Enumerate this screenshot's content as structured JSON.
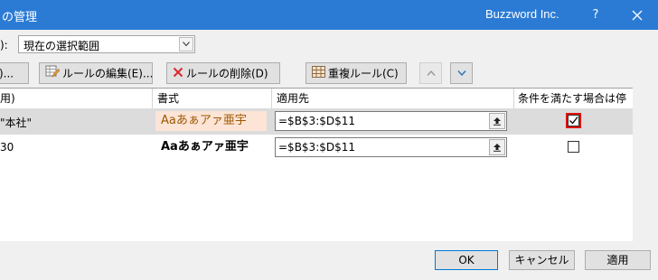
{
  "window": {
    "title": "の管理",
    "app_name": "Buzzword Inc.",
    "help_label": "?"
  },
  "scope": {
    "label": "):",
    "selected": "現在の選択範囲"
  },
  "toolbar": {
    "new_label": ")...",
    "edit_label": "ルールの編集(E)...",
    "delete_label": "ルールの削除(D)",
    "duplicate_label": "重複ルール(C)"
  },
  "columns": {
    "rule": "用)",
    "format": "書式",
    "applies_to": "適用先",
    "stop_if_true": "条件を満たす場合は停止"
  },
  "rules": [
    {
      "rule_text": "\"本社\"",
      "preview": "Aaあぁアァ亜宇",
      "applies_to": "=$B$3:$D$11",
      "stop_if_true": true
    },
    {
      "rule_text": "30",
      "preview": "Aaあぁアァ亜宇",
      "applies_to": "=$B$3:$D$11",
      "stop_if_true": false
    }
  ],
  "footer": {
    "ok_label": "OK",
    "cancel_label": "キャンセル",
    "apply_label": "適用"
  },
  "colors": {
    "titlebar": "#2b7bd5",
    "selected_row": "#dcdcdc",
    "preview_fill": "#fce4d6",
    "preview_text": "#9c5700",
    "checkbox_highlight": "#e01010"
  },
  "icons": {
    "edit_button": "edit-rule-icon",
    "delete_button": "delete-x-icon",
    "duplicate_button": "duplicate-grid-icon",
    "move_up": "chevron-up-icon",
    "move_down": "chevron-down-icon",
    "applies_collapse": "collapse-arrow-icon",
    "close": "close-icon"
  }
}
